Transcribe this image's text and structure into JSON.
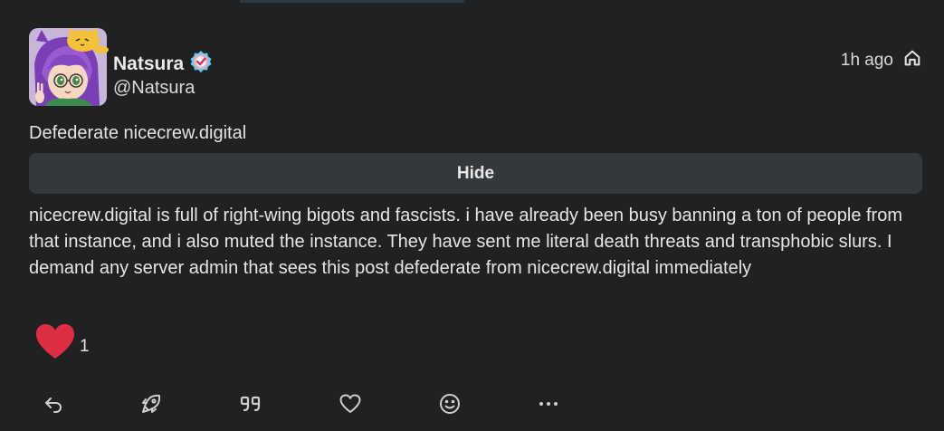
{
  "post": {
    "display_name": "Natsura",
    "handle": "@Natsura",
    "time": "1h ago",
    "visibility_icon": "home-icon",
    "cw": "Defederate nicecrew.digital",
    "hide_label": "Hide",
    "text": "nicecrew.digital is full of right-wing bigots and fascists. i have already been busy banning a ton of people from that instance, and i also muted the instance. They have sent me literal death threats and transphobic slurs. I demand any server admin that sees this post defederate from nicecrew.digital immediately"
  },
  "reaction": {
    "icon": "heart-emoji-icon",
    "count": "1"
  },
  "footer": {
    "icons": [
      "reply-icon",
      "renote-icon",
      "quote-icon",
      "like-icon",
      "emoji-react-icon",
      "more-icon"
    ]
  },
  "colors": {
    "background": "#202122",
    "hide_button": "#35383a",
    "heart": "#dd2e44",
    "badge_blue": "#5bcefa",
    "badge_pink": "#f5a9b8"
  }
}
